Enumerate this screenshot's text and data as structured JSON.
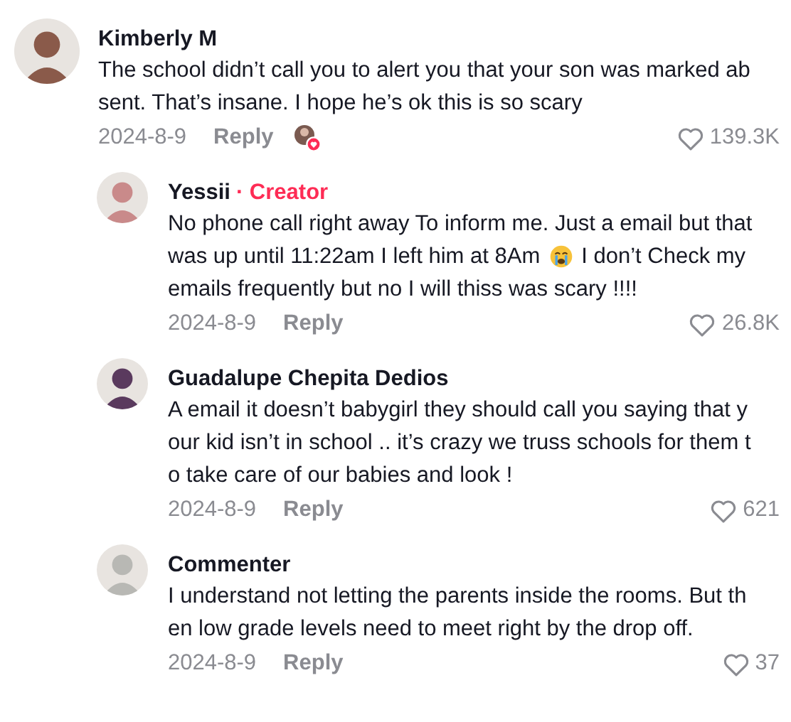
{
  "comments": [
    {
      "author": "Kimberly M",
      "lines": [
        [
          "The school didn’t call you to alert you that your son was marked ab"
        ],
        [
          "sent. That’s insane. I hope he’s ok this is so scary"
        ]
      ],
      "date": "2024-8-9",
      "reply_label": "Reply",
      "liked_by_creator": true,
      "likes": "139.3K",
      "replies": [
        {
          "author": "Yessii",
          "badge": "· Creator",
          "lines": [
            [
              "No phone call right away To inform me. Just a email but that"
            ],
            [
              "was up until 11:22am I left him at 8Am",
              "I don’t Check my"
            ],
            [
              "emails frequently but no I will thiss was scary !!!!"
            ]
          ],
          "date": "2024-8-9",
          "reply_label": "Reply",
          "liked_by_creator": false,
          "likes": "26.8K"
        },
        {
          "author": "Guadalupe Chepita Dedios",
          "lines": [
            [
              "A email it doesn’t babygirl they should call you saying that y"
            ],
            [
              "our kid isn’t in school .. it’s crazy we truss schools for them t"
            ],
            [
              "o take care of our babies and look !"
            ]
          ],
          "date": "2024-8-9",
          "reply_label": "Reply",
          "liked_by_creator": false,
          "likes": "621"
        },
        {
          "author": "Commenter",
          "lines": [
            [
              "I understand not letting the parents inside the rooms. But th"
            ],
            [
              "en low grade levels need to meet right by the drop off."
            ]
          ],
          "date": "2024-8-9",
          "reply_label": "Reply",
          "liked_by_creator": false,
          "likes": "37"
        }
      ]
    }
  ]
}
